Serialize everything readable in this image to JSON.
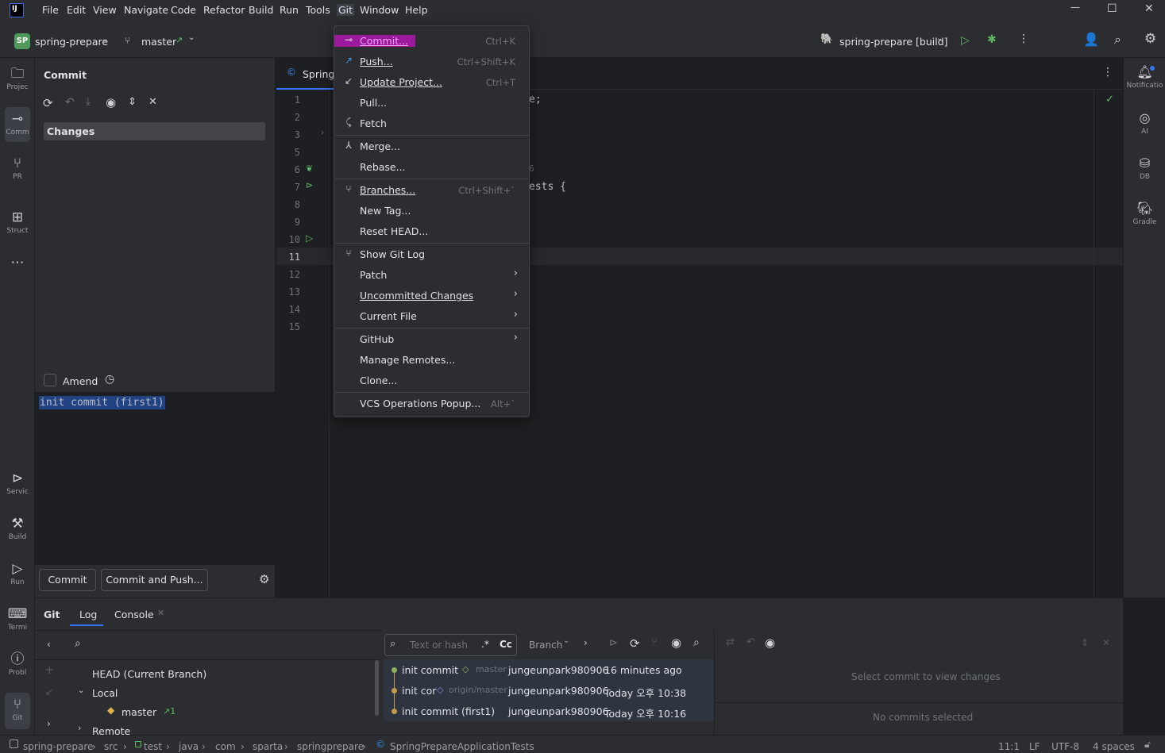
{
  "menubar": {
    "app_logo": "IJ",
    "items": [
      "File",
      "Edit",
      "View",
      "Navigate",
      "Code",
      "Refactor",
      "Build",
      "Run",
      "Tools",
      "Git",
      "Window",
      "Help"
    ],
    "active_item": "Git"
  },
  "window_controls": {
    "minimize": "—",
    "maximize": "☐",
    "close": "✕"
  },
  "toolbar": {
    "project_badge": "SP",
    "project_name": "spring-prepare",
    "branch": "master",
    "branch_arrow": "↗",
    "run_config": "spring-prepare [build]"
  },
  "left_toolwindows": [
    {
      "label": "Projec",
      "icon": "folder-icon"
    },
    {
      "label": "Comm",
      "icon": "commit-icon"
    },
    {
      "label": "PR",
      "icon": "pull-request-icon"
    },
    {
      "label": "Struct",
      "icon": "structure-icon"
    },
    {
      "label": "Servic",
      "icon": "services-icon"
    },
    {
      "label": "Build",
      "icon": "build-icon"
    },
    {
      "label": "Run",
      "icon": "run-icon"
    },
    {
      "label": "Termi",
      "icon": "terminal-icon"
    },
    {
      "label": "Probl",
      "icon": "problems-icon"
    },
    {
      "label": "Git",
      "icon": "git-icon"
    }
  ],
  "right_toolwindows": [
    {
      "label": "Notificatio",
      "icon": "bell-icon"
    },
    {
      "label": "AI",
      "icon": "ai-icon"
    },
    {
      "label": "DB",
      "icon": "database-icon"
    },
    {
      "label": "Gradle",
      "icon": "gradle-icon"
    }
  ],
  "commit_panel": {
    "title": "Commit",
    "changes_label": "Changes",
    "amend_label": "Amend",
    "message": "init commit (first1)",
    "commit_button": "Commit",
    "commit_push_button": "Commit and Push..."
  },
  "editor": {
    "tab_label": "SpringP",
    "line_numbers": [
      "1",
      "2",
      "3",
      "5",
      "6",
      "7",
      "8",
      "9",
      "10",
      "11",
      "12",
      "13",
      "14",
      "15"
    ],
    "current_line": "11",
    "visible_code": [
      {
        "line": "1",
        "text": "e;"
      },
      {
        "line": "6",
        "text": "6"
      },
      {
        "line": "7",
        "text": "ests {"
      }
    ]
  },
  "git_menu": {
    "items": [
      {
        "label": "Commit...",
        "shortcut": "Ctrl+K",
        "icon": "commit-icon",
        "highlighted": true
      },
      {
        "label": "Push...",
        "shortcut": "Ctrl+Shift+K",
        "icon": "push-icon"
      },
      {
        "label": "Update Project...",
        "shortcut": "Ctrl+T",
        "icon": "update-icon"
      },
      {
        "label": "Pull...",
        "shortcut": "",
        "icon": ""
      },
      {
        "label": "Fetch",
        "shortcut": "",
        "icon": "fetch-icon"
      },
      {
        "label": "Merge...",
        "shortcut": "",
        "icon": "merge-icon"
      },
      {
        "label": "Rebase...",
        "shortcut": "",
        "icon": ""
      },
      {
        "label": "Branches...",
        "shortcut": "Ctrl+Shift+`",
        "icon": "branch-icon"
      },
      {
        "label": "New Tag...",
        "shortcut": "",
        "icon": ""
      },
      {
        "label": "Reset HEAD...",
        "shortcut": "",
        "icon": ""
      },
      {
        "label": "Show Git Log",
        "shortcut": "",
        "icon": "git-log-icon"
      },
      {
        "label": "Patch",
        "shortcut": "",
        "icon": "",
        "submenu": true
      },
      {
        "label": "Uncommitted Changes",
        "shortcut": "",
        "icon": "",
        "submenu": true
      },
      {
        "label": "Current File",
        "shortcut": "",
        "icon": "",
        "submenu": true
      },
      {
        "label": "GitHub",
        "shortcut": "",
        "icon": "",
        "submenu": true
      },
      {
        "label": "Manage Remotes...",
        "shortcut": "",
        "icon": ""
      },
      {
        "label": "Clone...",
        "shortcut": "",
        "icon": ""
      },
      {
        "label": "VCS Operations Popup...",
        "shortcut": "Alt+`",
        "icon": ""
      }
    ]
  },
  "bottom_panel": {
    "tabs": [
      "Git",
      "Log",
      "Console"
    ],
    "branch_tree": {
      "head": "HEAD (Current Branch)",
      "local": "Local",
      "master": "master",
      "master_ahead": "↗1",
      "remote": "Remote"
    },
    "log_search_placeholder": "Text or hash",
    "regex_label": ".*",
    "case_label": "Cc",
    "branch_filter": "Branch",
    "commits": [
      {
        "message": "init commit",
        "ref": "master",
        "author": "jungeunpark980906",
        "date": "16 minutes ago",
        "dot_color": "#8fb05a"
      },
      {
        "message": "init cor",
        "ref": "origin/master",
        "author": "jungeunpark980906",
        "date": "Today 오후 10:38",
        "dot_color": "#c49a4b"
      },
      {
        "message": "init commit (first1)",
        "ref": "",
        "author": "jungeunpark980906",
        "date": "Today 오후 10:16",
        "dot_color": "#c49a4b"
      }
    ],
    "select_commit_hint": "Select commit to view changes",
    "no_commits": "No commits selected"
  },
  "statusbar": {
    "breadcrumbs": [
      "spring-prepare",
      "src",
      "test",
      "java",
      "com",
      "sparta",
      "springprepare",
      "SpringPrepareApplicationTests"
    ],
    "position": "11:1",
    "line_ending": "LF",
    "encoding": "UTF-8",
    "indent": "4 spaces"
  }
}
